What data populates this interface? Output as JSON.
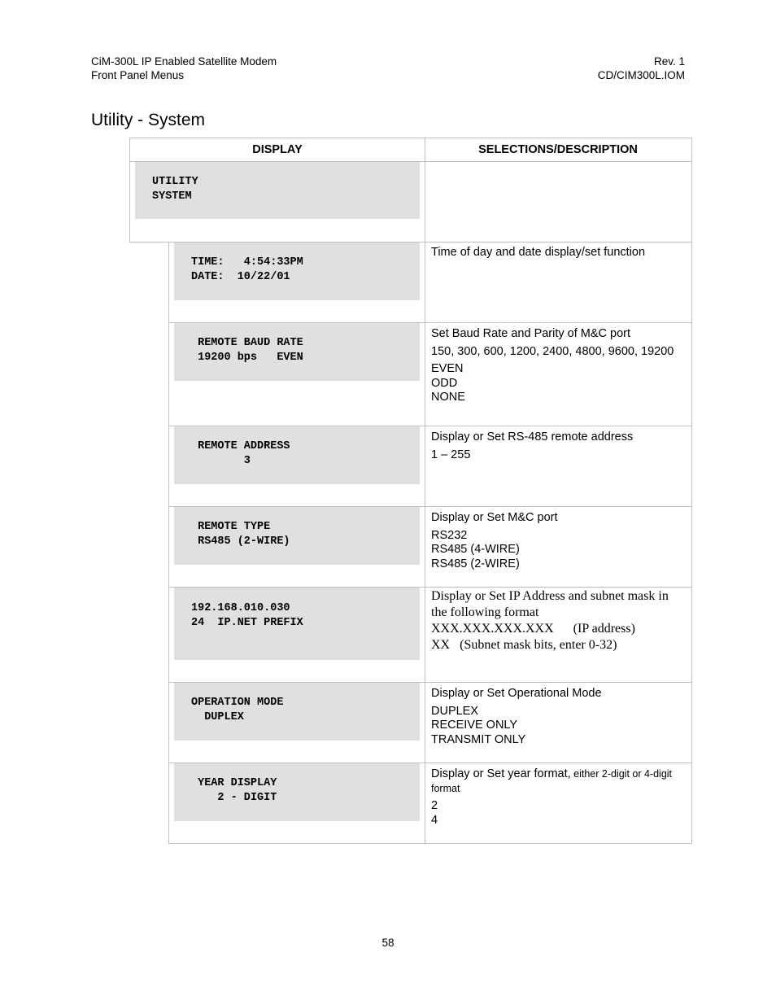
{
  "header": {
    "left_line1": "CiM-300L IP Enabled Satellite Modem",
    "left_line2": "Front Panel Menus",
    "right_line1": "Rev. 1",
    "right_line2": "CD/CIM300L.IOM"
  },
  "section_title": "Utility - System",
  "table": {
    "col_display": "DISPLAY",
    "col_desc": "SELECTIONS/DESCRIPTION",
    "rows": [
      {
        "display": "UTILITY\nSYSTEM",
        "desc_title": "",
        "desc_items": []
      },
      {
        "display": "TIME:   4:54:33PM\nDATE:  10/22/01",
        "desc_title": "Time of day and date display/set function",
        "desc_items": []
      },
      {
        "display": " REMOTE BAUD RATE\n 19200 bps   EVEN",
        "desc_title": "Set Baud Rate and Parity of M&C port",
        "desc_items": [
          "150, 300, 600, 1200, 2400, 4800, 9600, 19200",
          "EVEN\nODD\nNONE"
        ]
      },
      {
        "display": " REMOTE ADDRESS\n        3",
        "desc_title": "Display or Set RS-485 remote address",
        "desc_items": [
          "1 – 255"
        ]
      },
      {
        "display": " REMOTE TYPE\n RS485 (2-WIRE)",
        "desc_title": "Display or Set M&C port",
        "desc_items": [
          "RS232\nRS485 (4-WIRE)\nRS485 (2-WIRE)"
        ]
      },
      {
        "display": "192.168.010.030\n24  IP.NET PREFIX",
        "desc_title": "Display or Set IP Address and subnet mask in the following format",
        "desc_items": [
          "XXX.XXX.XXX.XXX      (IP address)",
          "XX   (Subnet mask bits, enter 0-32)"
        ]
      },
      {
        "display": "OPERATION MODE\n  DUPLEX",
        "desc_title": "Display or Set Operational Mode",
        "desc_items": [
          "DUPLEX\nRECEIVE ONLY\nTRANSMIT ONLY"
        ]
      },
      {
        "display": " YEAR DISPLAY\n    2 - DIGIT",
        "desc_title": "Display or Set  year format,",
        "desc_title_small": " either 2-digit or 4-digit format",
        "desc_items": [
          "2\n4"
        ]
      }
    ]
  },
  "page_number": "58"
}
